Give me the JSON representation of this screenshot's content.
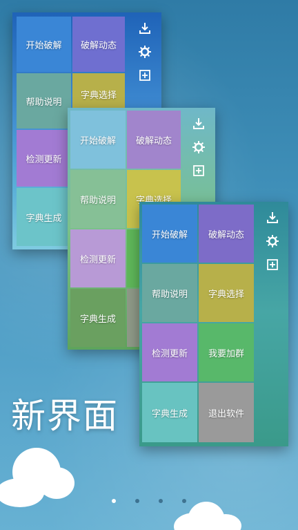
{
  "headline": "新界面",
  "panels": [
    {
      "tiles": [
        "开始破解",
        "破解动态",
        "帮助说明",
        "字典选择",
        "检测更新",
        "字典生成"
      ]
    },
    {
      "tiles": [
        "开始破解",
        "破解动态",
        "帮助说明",
        "字典选择",
        "检测更新",
        "字典生成"
      ]
    },
    {
      "tiles": [
        "开始破解",
        "破解动态",
        "帮助说明",
        "字典选择",
        "检测更新",
        "我要加群",
        "字典生成",
        "退出软件"
      ]
    }
  ],
  "side_icons": [
    "download-icon",
    "gear-icon",
    "add-icon"
  ],
  "carousel": {
    "count": 4,
    "active_index": 0
  },
  "colors": {
    "blue": "#3a86d6",
    "purple": "#7d6cc8",
    "teal": "#6aa8a0",
    "olive": "#b7b04a",
    "violet": "#a27bd3",
    "cyan": "#68c3c1",
    "green": "#58b86a",
    "gray": "#9a9a9a"
  }
}
